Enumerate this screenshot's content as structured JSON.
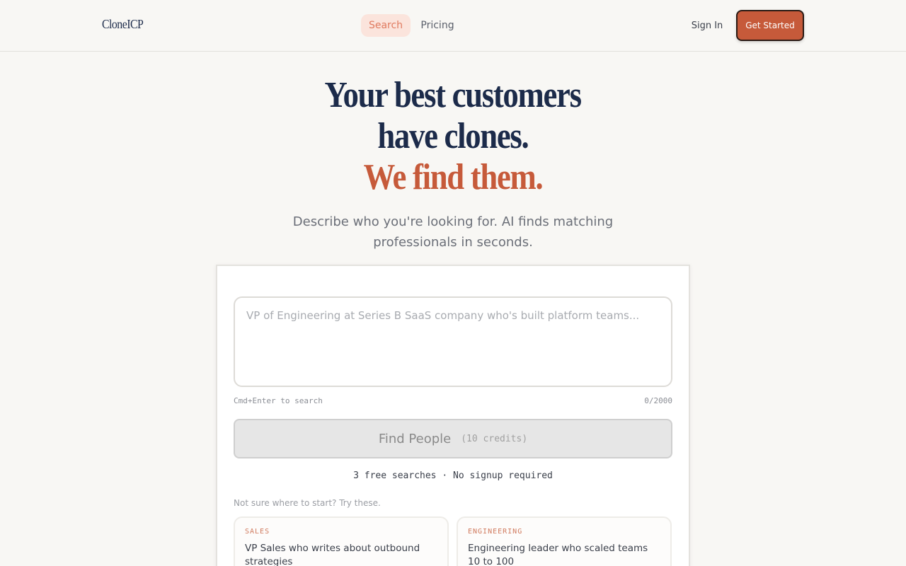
{
  "header": {
    "logo": "CloneICP",
    "nav": [
      {
        "label": "Search",
        "active": true
      },
      {
        "label": "Pricing",
        "active": false
      }
    ],
    "sign_in": "Sign In",
    "get_started": "Get Started"
  },
  "hero": {
    "line1": "Your best customers",
    "line2": "have clones.",
    "line3": "We find them.",
    "subtitle": "Describe who you're looking for. AI finds matching professionals in seconds."
  },
  "search": {
    "placeholder": "VP of Engineering at Series B SaaS company who's built platform teams...",
    "shortcut_hint": "Cmd+Enter to search",
    "char_count": "0/2000",
    "button_label": "Find People",
    "button_credits": "(10 credits)",
    "free_note": "3 free searches · No signup required",
    "try_prompt": "Not sure where to start? Try these."
  },
  "suggestions": [
    {
      "tag": "SALES",
      "text": "VP Sales who writes about outbound strategies"
    },
    {
      "tag": "ENGINEERING",
      "text": "Engineering leader who scaled teams 10 to 100"
    }
  ],
  "colors": {
    "background": "#f8f7f4",
    "navy": "#1c2b4a",
    "accent": "#c65a3a",
    "accent_light": "#fbe4dc"
  }
}
